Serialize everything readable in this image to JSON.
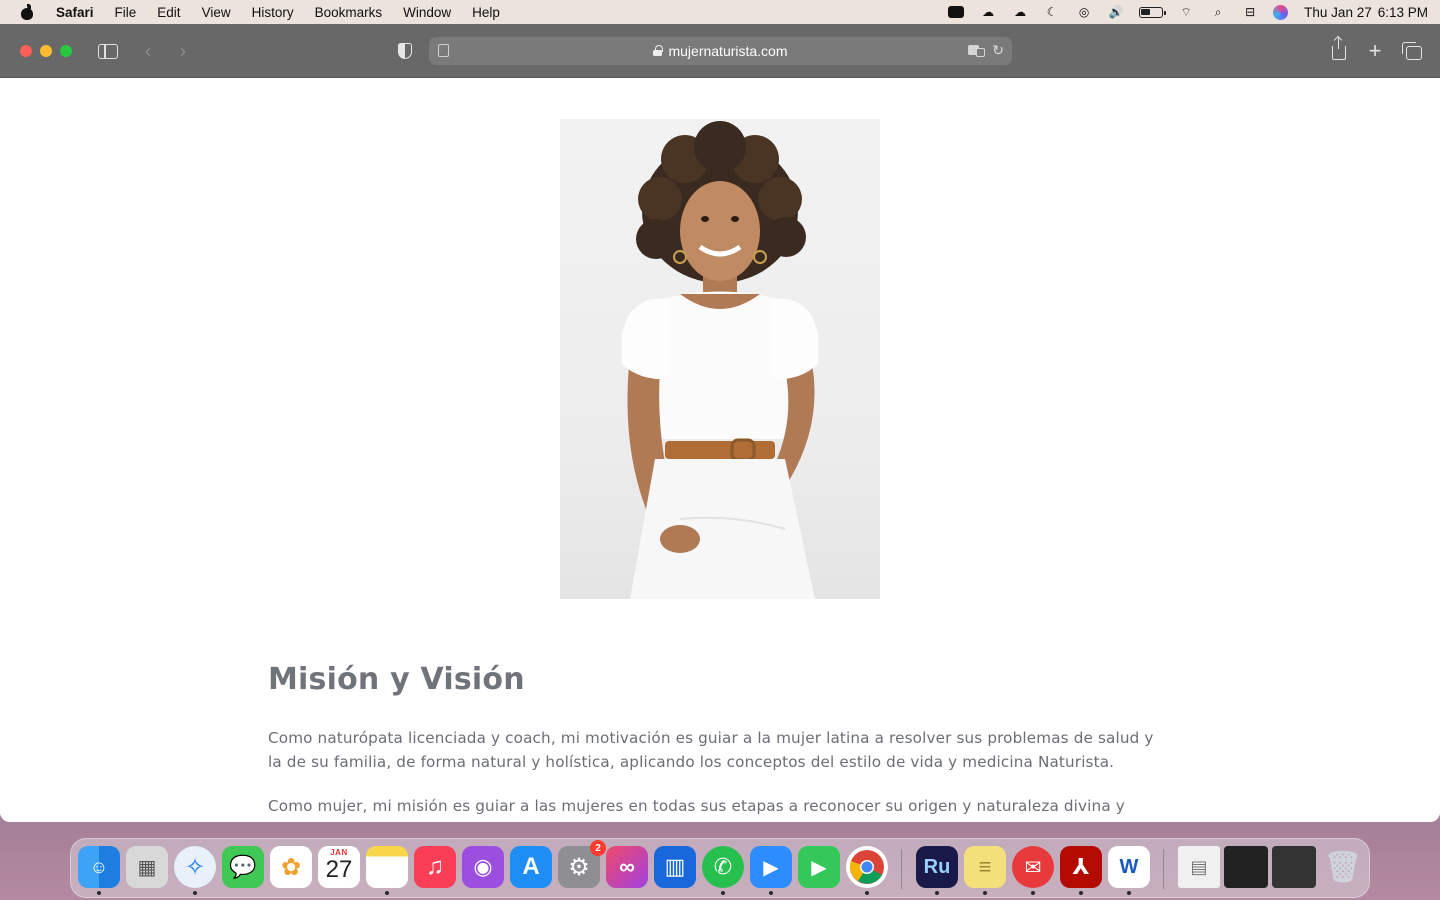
{
  "menubar": {
    "app_name": "Safari",
    "items": [
      "File",
      "Edit",
      "View",
      "History",
      "Bookmarks",
      "Window",
      "Help"
    ],
    "clock_day": "Thu Jan 27",
    "clock_time": "6:13 PM"
  },
  "browser": {
    "url": "mujernaturista.com"
  },
  "page": {
    "section_title": "Misión y Visión",
    "paragraph_1": "Como naturópata licenciada y coach, mi motivación es guiar a la mujer latina a resolver sus problemas de salud y la de su familia, de forma natural y holística, aplicando los conceptos del estilo de vida y medicina Naturista.",
    "paragraph_2": "Como mujer, mi misión es guiar a las  mujeres en todas sus etapas a reconocer su origen y naturaleza divina y"
  },
  "dock": {
    "calendar_month": "JAN",
    "calendar_day": "27",
    "settings_badge": "2",
    "ru_label": "Ru",
    "word_label": "W"
  },
  "colors": {
    "toolbar": "#686868",
    "heading": "#6f747b",
    "body_text": "#6a6f76"
  }
}
